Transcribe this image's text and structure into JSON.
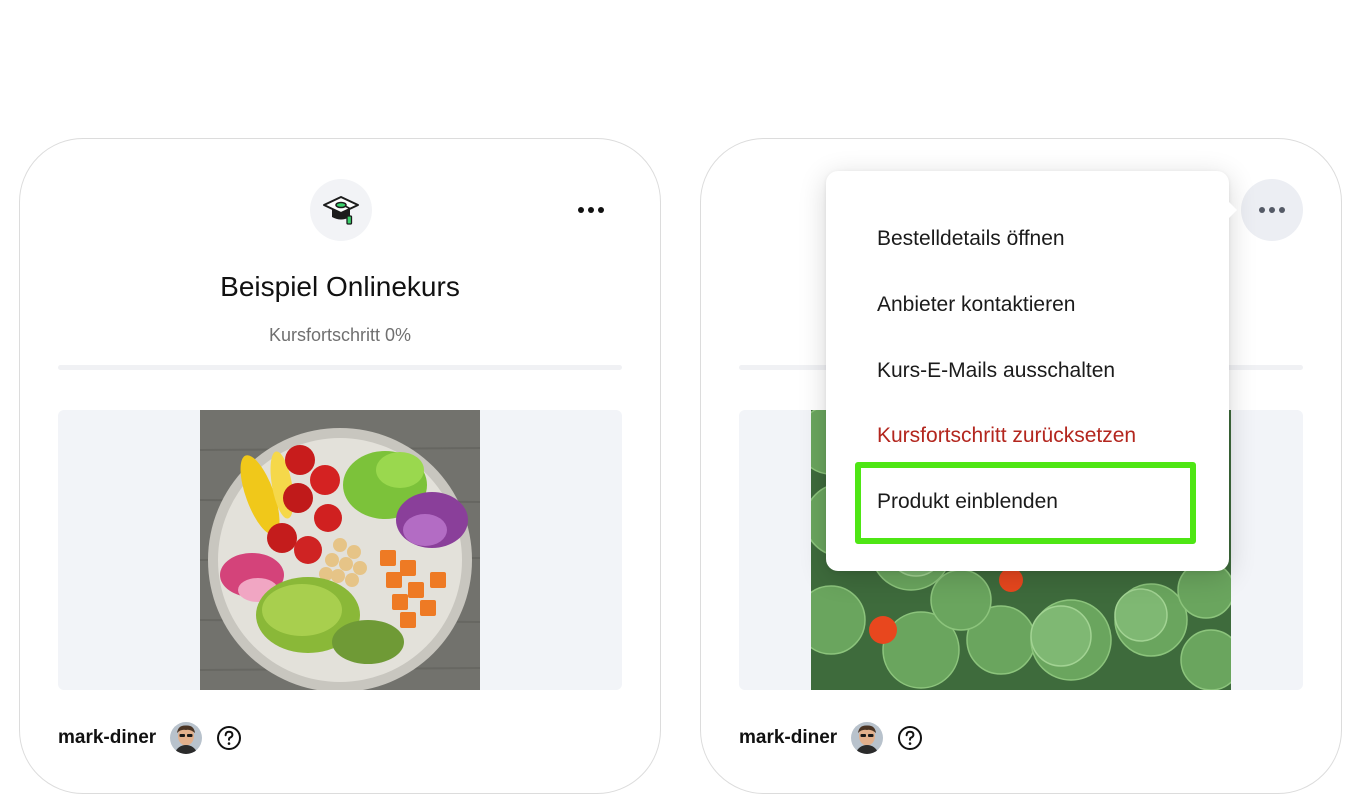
{
  "cards": [
    {
      "title": "Beispiel Onlinekurs",
      "progress_text": "Kursfortschritt 0%",
      "progress": 0,
      "image": "salad-bowl-photo",
      "author": "mark-diner"
    },
    {
      "image": "nasturtium-leaves-photo",
      "author": "mark-diner"
    }
  ],
  "menu": {
    "items": [
      {
        "label": "Bestelldetails öffnen"
      },
      {
        "label": "Anbieter kontaktieren"
      },
      {
        "label": "Kurs-E-Mails ausschalten"
      },
      {
        "label": "Kursfortschritt zurücksetzen",
        "color": "#b3261e"
      },
      {
        "label": "Produkt einblenden",
        "highlighted": true
      }
    ],
    "highlight_color": "#4ee614"
  },
  "icons": {
    "course": "graduation-cap-icon",
    "more": "more-horizontal-icon",
    "help": "question-circle-icon"
  }
}
